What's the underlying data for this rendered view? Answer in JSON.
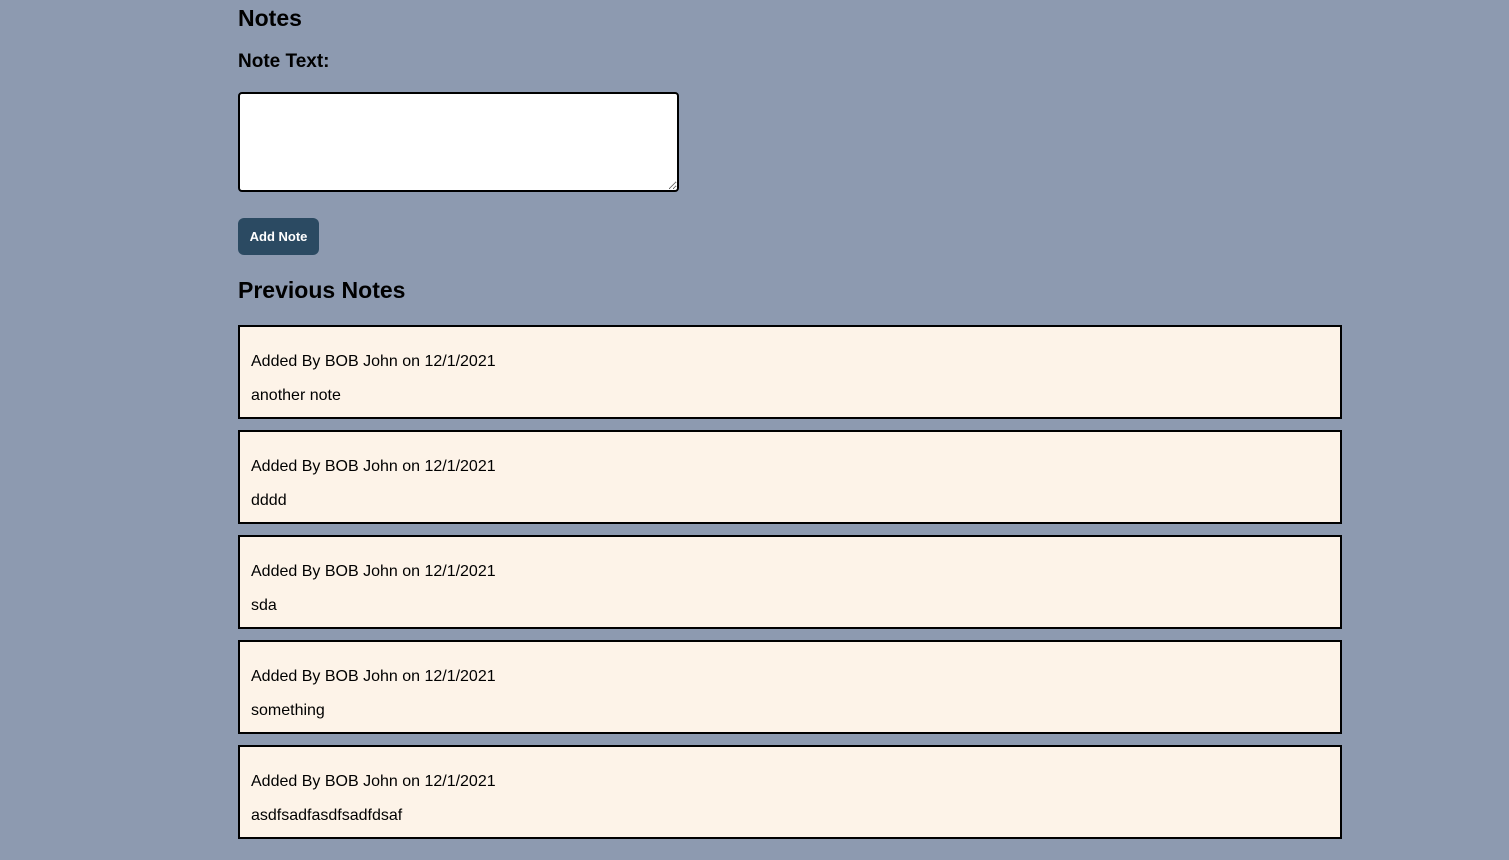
{
  "form": {
    "title": "Notes",
    "note_label": "Note Text:",
    "note_value": "",
    "add_button_label": "Add Note"
  },
  "previous": {
    "title": "Previous Notes",
    "notes": [
      {
        "meta": "Added By BOB John on 12/1/2021",
        "text": "another note"
      },
      {
        "meta": "Added By BOB John on 12/1/2021",
        "text": "dddd"
      },
      {
        "meta": "Added By BOB John on 12/1/2021",
        "text": "sda"
      },
      {
        "meta": "Added By BOB John on 12/1/2021",
        "text": "something"
      },
      {
        "meta": "Added By BOB John on 12/1/2021",
        "text": "asdfsadfasdfsadfdsaf"
      }
    ]
  },
  "colors": {
    "background": "#8d9ab0",
    "button": "#2b4a62",
    "card": "#fdf3e8"
  }
}
